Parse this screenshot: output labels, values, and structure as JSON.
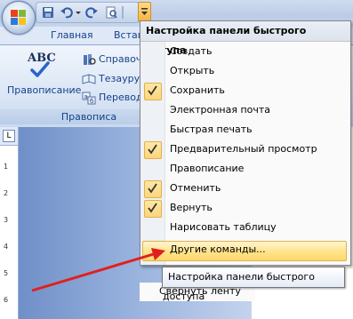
{
  "ribbon": {
    "tabs": [
      "Главная",
      "Вставка"
    ],
    "spelling_label": "Правописание",
    "spelling_big_icon_text": "ABC",
    "small_buttons": [
      "Справочн",
      "Тезаурус",
      "Перевод"
    ],
    "group_label": "Правописа"
  },
  "ruler": {
    "corner": "L",
    "marks": [
      "1",
      "2",
      "3",
      "4",
      "5",
      "6"
    ]
  },
  "menu": {
    "header": "Настройка панели быстрого доступа",
    "items": [
      {
        "label": "Создать",
        "checked": false
      },
      {
        "label": "Открыть",
        "checked": false
      },
      {
        "label": "Сохранить",
        "checked": true
      },
      {
        "label": "Электронная почта",
        "checked": false
      },
      {
        "label": "Быстрая печать",
        "checked": false
      },
      {
        "label": "Предварительный просмотр",
        "checked": true
      },
      {
        "label": "Правописание",
        "checked": false
      },
      {
        "label": "Отменить",
        "checked": true
      },
      {
        "label": "Вернуть",
        "checked": true
      },
      {
        "label": "Нарисовать таблицу",
        "checked": false
      },
      {
        "label": "Другие команды...",
        "checked": false,
        "highlighted": true
      }
    ]
  },
  "tooltip": "Настройка панели быстрого доступа",
  "below_item": "Свернуть ленту",
  "colors": {
    "accent": "#15428b",
    "highlight": "#ffe48f",
    "arrow": "#e0201e"
  }
}
